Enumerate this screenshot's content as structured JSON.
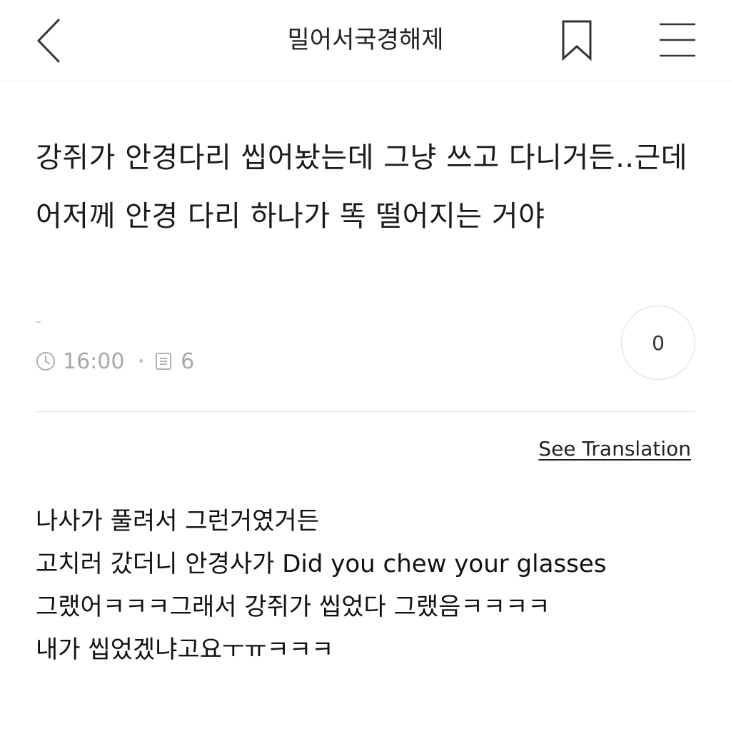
{
  "header": {
    "board_title": "밀어서국경해제",
    "back_icon": "chevron-left-icon",
    "bookmark_icon": "bookmark-icon",
    "menu_icon": "hamburger-menu-icon"
  },
  "post": {
    "title": "강쥐가 안경다리 씹어놨는데 그냥 쓰고 다니거든..근데 어저께 안경 다리 하나가 똑 떨어지는 거야",
    "author": "-",
    "time": "16:00",
    "comment_count": "6",
    "like_count": "0",
    "translate_label": "See Translation",
    "body_lines": [
      "나사가 풀려서 그런거였거든",
      "고치러 갔더니 안경사가 Did you chew your glasses",
      "그랬어ㅋㅋㅋ그래서 강쥐가 씹었다 그랬음ㅋㅋㅋㅋ",
      "내가 씹었겠냐고요ㅜㅠㅋㅋㅋ"
    ]
  },
  "colors": {
    "text": "#1a1a1a",
    "muted": "#a8a8a8",
    "divider": "#e4e4e4"
  }
}
